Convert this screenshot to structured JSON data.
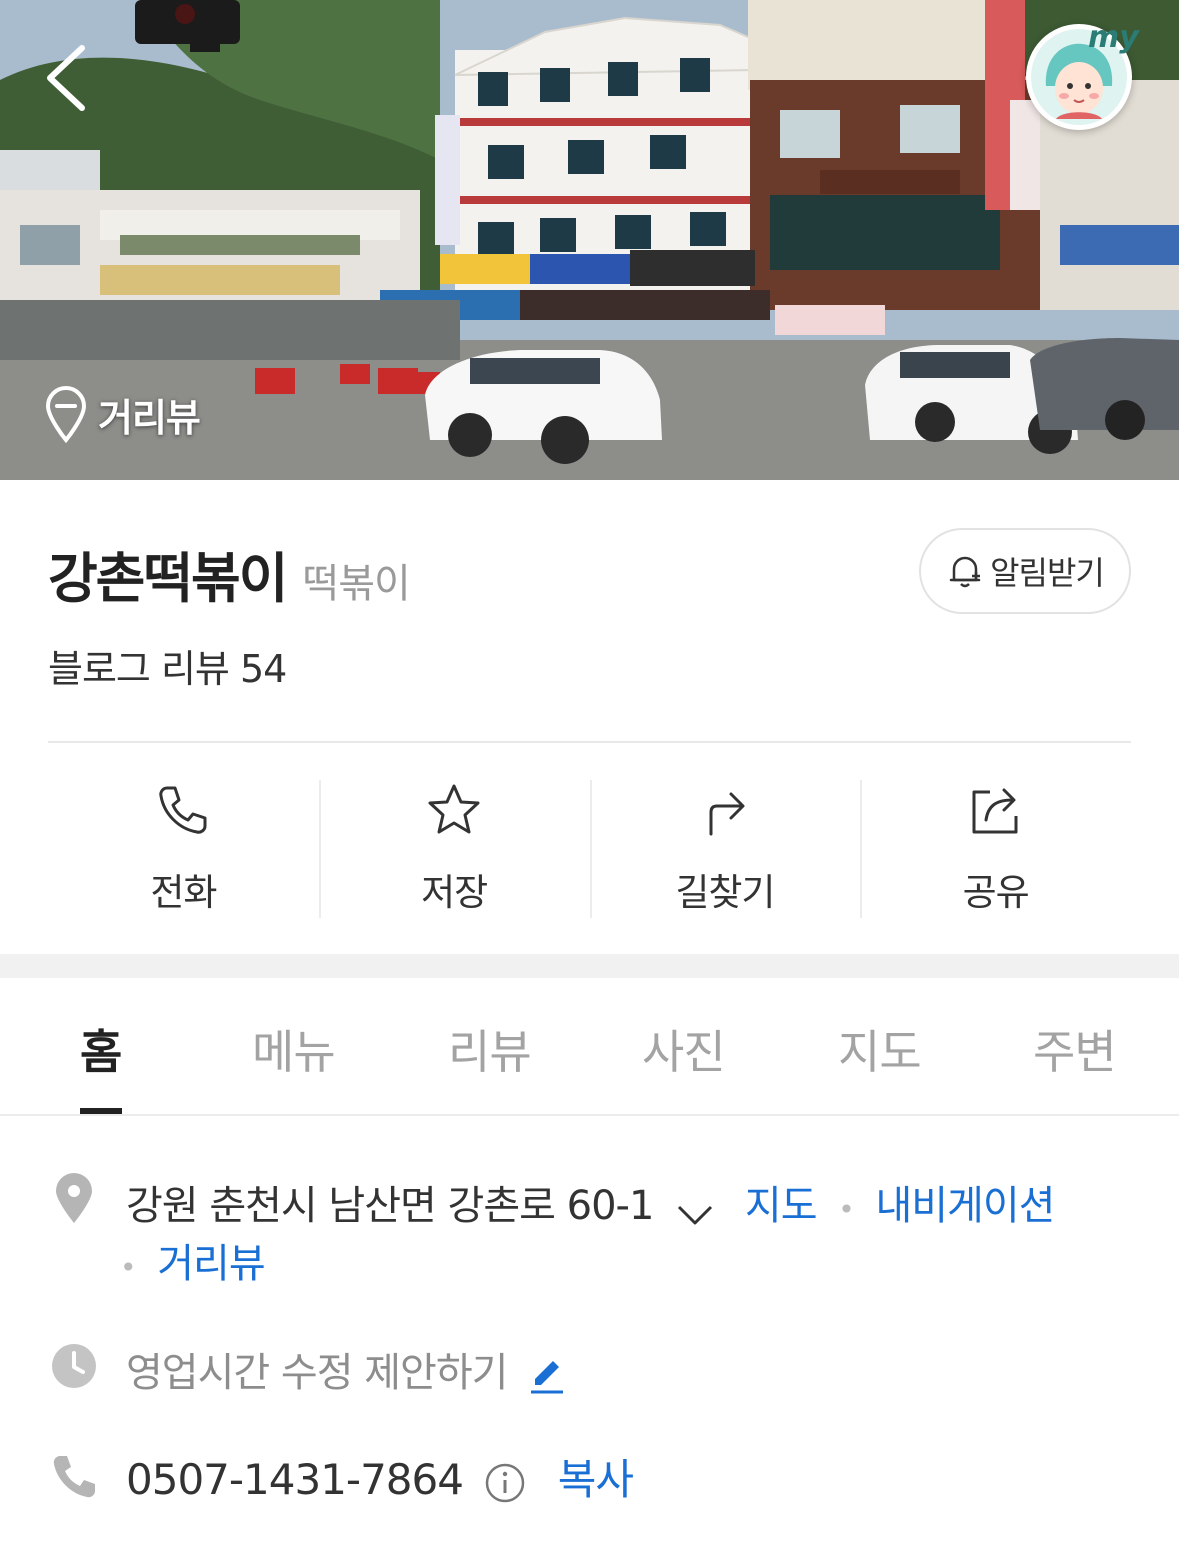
{
  "hero": {
    "back_icon": "chevron-left-icon",
    "avatar_label": "my",
    "streetview_label": "거리뷰"
  },
  "place": {
    "name": "강촌떡볶이",
    "category": "떡볶이",
    "notify_label": "알림받기",
    "review_summary": "블로그 리뷰 54"
  },
  "actions": [
    {
      "label": "전화",
      "icon": "phone-icon"
    },
    {
      "label": "저장",
      "icon": "star-icon"
    },
    {
      "label": "길찾기",
      "icon": "directions-icon"
    },
    {
      "label": "공유",
      "icon": "share-icon"
    }
  ],
  "tabs": [
    {
      "label": "홈",
      "active": true
    },
    {
      "label": "메뉴",
      "active": false
    },
    {
      "label": "리뷰",
      "active": false
    },
    {
      "label": "사진",
      "active": false
    },
    {
      "label": "지도",
      "active": false
    },
    {
      "label": "주변",
      "active": false
    }
  ],
  "info": {
    "address": "강원 춘천시 남산면 강촌로 60-1",
    "map_link": "지도",
    "navigation_link": "내비게이션",
    "streetview_link": "거리뷰",
    "hours_suggest": "영업시간 수정 제안하기",
    "phone": "0507-1431-7864",
    "copy_label": "복사"
  },
  "colors": {
    "link": "#1a6fd4",
    "text_primary": "#222222",
    "text_muted": "#9a9a9a"
  }
}
